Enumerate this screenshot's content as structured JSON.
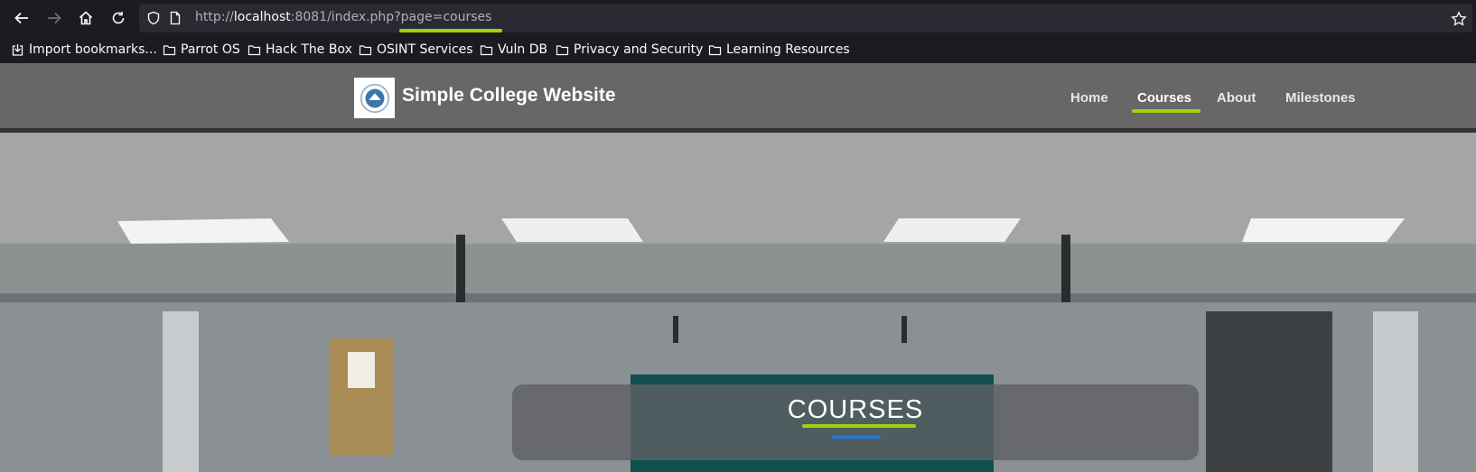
{
  "browser": {
    "url": {
      "scheme": "http://",
      "host": "localhost",
      "rest": ":8081/index.php?page=courses"
    }
  },
  "bookmarks": [
    {
      "label": "Import bookmarks...",
      "icon": "import-icon"
    },
    {
      "label": "Parrot OS",
      "icon": "folder-icon"
    },
    {
      "label": "Hack The Box",
      "icon": "folder-icon"
    },
    {
      "label": "OSINT Services",
      "icon": "folder-icon"
    },
    {
      "label": "Vuln DB",
      "icon": "folder-icon"
    },
    {
      "label": "Privacy and Security",
      "icon": "folder-icon"
    },
    {
      "label": "Learning Resources",
      "icon": "folder-icon"
    }
  ],
  "site": {
    "brand": "Simple College Website",
    "nav": [
      "Home",
      "Courses",
      "About",
      "Milestones"
    ],
    "active_nav": "Courses",
    "page_heading": "COURSES"
  },
  "colors": {
    "accent_green": "#9dd40f",
    "accent_blue": "#1e7ad6",
    "header_bg": "#676767",
    "browser_bg": "#1c1b22"
  }
}
